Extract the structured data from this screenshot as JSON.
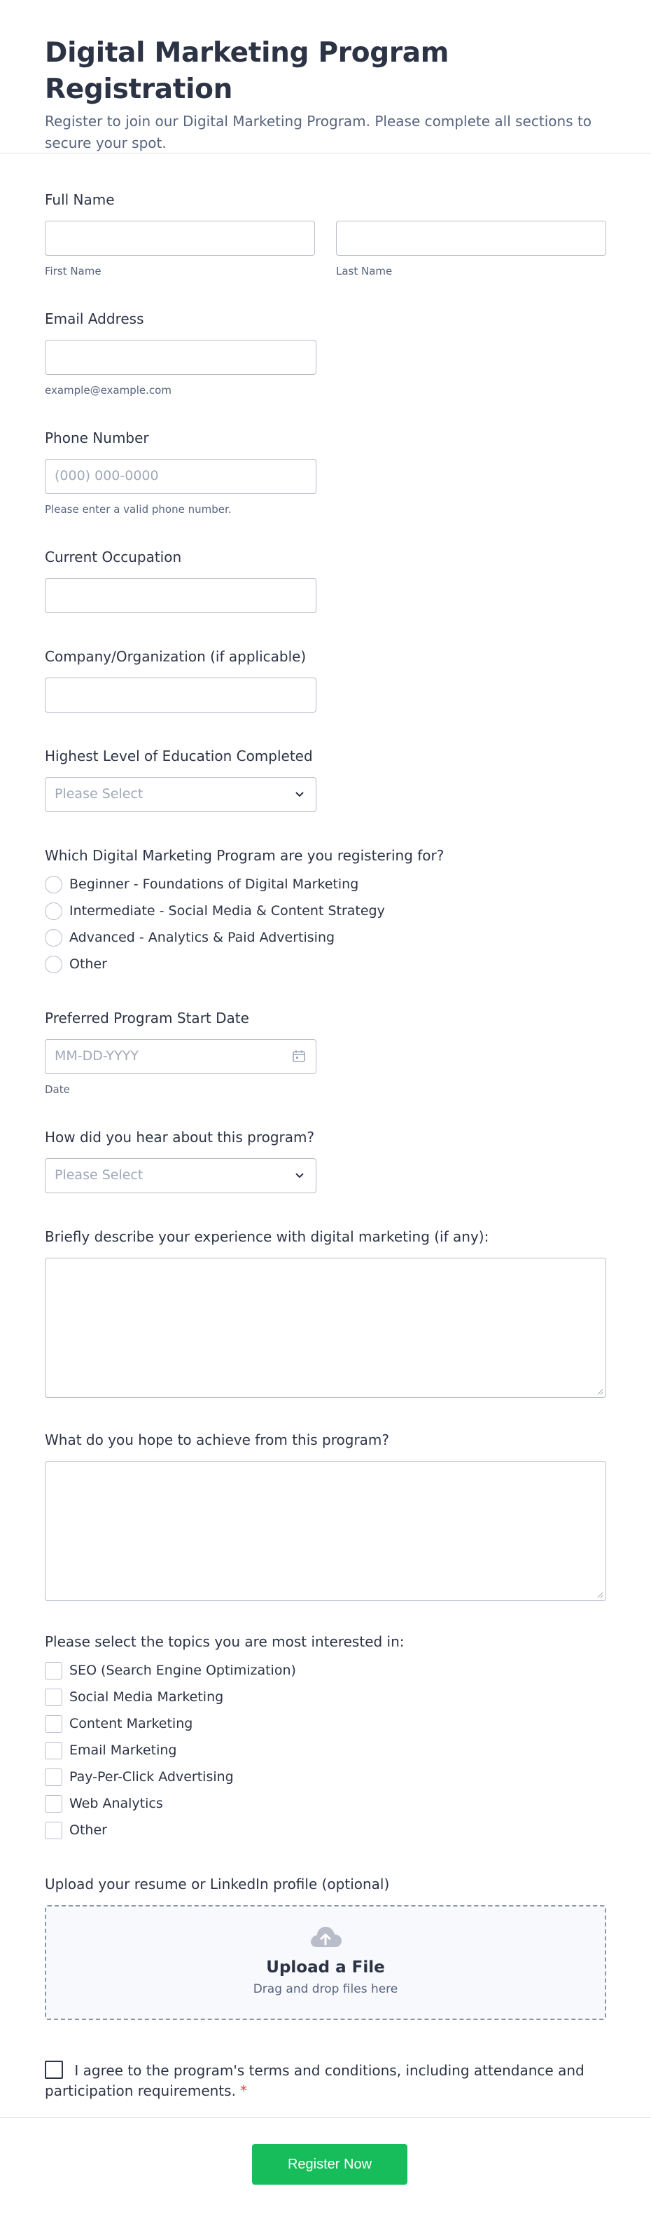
{
  "header": {
    "title": "Digital Marketing Program Registration",
    "subtitle": "Register to join our Digital Marketing Program. Please complete all sections to secure your spot."
  },
  "full_name": {
    "label": "Full Name",
    "first_sub": "First Name",
    "last_sub": "Last Name",
    "first_value": "",
    "last_value": ""
  },
  "email": {
    "label": "Email Address",
    "sub": "example@example.com",
    "value": ""
  },
  "phone": {
    "label": "Phone Number",
    "placeholder": "(000) 000-0000",
    "sub": "Please enter a valid phone number."
  },
  "occupation": {
    "label": "Current Occupation",
    "value": ""
  },
  "company": {
    "label": "Company/Organization (if applicable)",
    "value": ""
  },
  "education": {
    "label": "Highest Level of Education Completed",
    "placeholder": "Please Select"
  },
  "program": {
    "label": "Which Digital Marketing Program are you registering for?",
    "options": [
      "Beginner - Foundations of Digital Marketing",
      "Intermediate - Social Media & Content Strategy",
      "Advanced - Analytics & Paid Advertising",
      "Other"
    ]
  },
  "start_date": {
    "label": "Preferred Program Start Date",
    "placeholder": "MM-DD-YYYY",
    "sub": "Date"
  },
  "hear": {
    "label": "How did you hear about this program?",
    "placeholder": "Please Select"
  },
  "experience": {
    "label": "Briefly describe your experience with digital marketing (if any):"
  },
  "achieve": {
    "label": "What do you hope to achieve from this program?"
  },
  "topics": {
    "label": "Please select the topics you are most interested in:",
    "options": [
      "SEO (Search Engine Optimization)",
      "Social Media Marketing",
      "Content Marketing",
      "Email Marketing",
      "Pay-Per-Click Advertising",
      "Web Analytics",
      "Other"
    ]
  },
  "upload": {
    "label": "Upload your resume or LinkedIn profile (optional)",
    "title": "Upload a File",
    "sub": "Drag and drop files here"
  },
  "agree": {
    "text": "I agree to the program's terms and conditions, including attendance and participation requirements.",
    "required_mark": "*"
  },
  "submit": {
    "label": "Register Now"
  },
  "colors": {
    "accent": "#18bd5b",
    "text": "#2c3345",
    "muted": "#57647e",
    "border": "#b8bdc9",
    "required": "#f23a3c"
  },
  "icons": {
    "select": "chevron-down-icon",
    "date": "calendar-icon",
    "upload": "cloud-upload-icon"
  }
}
